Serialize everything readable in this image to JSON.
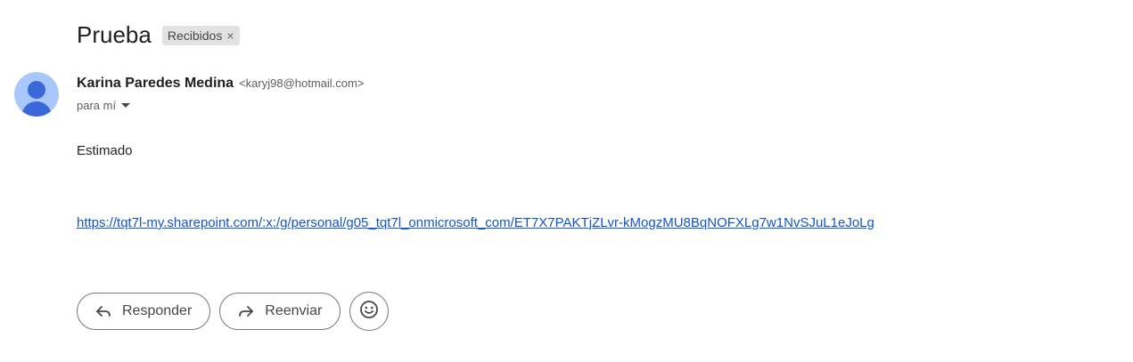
{
  "message": {
    "subject": "Prueba",
    "label": "Recibidos",
    "label_remove": "×"
  },
  "sender": {
    "name": "Karina Paredes Medina",
    "email": "<karyj98@hotmail.com>",
    "recipient": "para mí",
    "avatar_icon": "person-avatar-icon"
  },
  "body": {
    "greeting": "Estimado",
    "link": "https://tqt7l-my.sharepoint.com/:x:/g/personal/g05_tqt7l_onmicrosoft_com/ET7X7PAKTjZLvr-kMogzMU8BqNOFXLg7w1NvSJuL1eJoLg"
  },
  "actions": {
    "reply_label": "Responder",
    "reply_icon": "reply-arrow-icon",
    "forward_label": "Reenviar",
    "forward_icon": "forward-arrow-icon",
    "emoji_icon": "emoji-smile-icon"
  },
  "colors": {
    "link": "#1155cc",
    "avatar_bg": "#a8c7fa",
    "avatar_fg": "#3b68d8",
    "chip_bg": "#e2e2e2"
  }
}
